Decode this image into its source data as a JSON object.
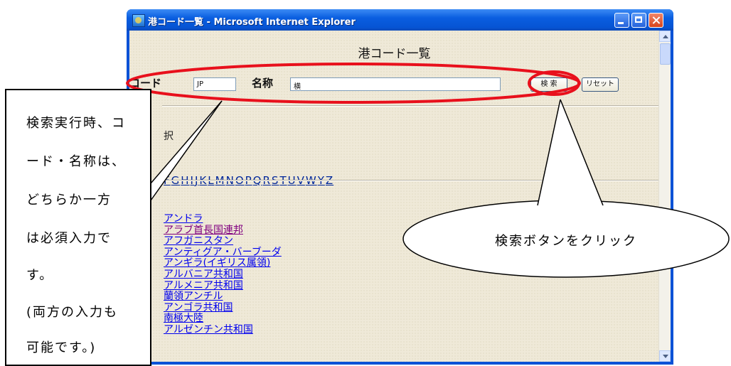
{
  "window": {
    "title": "港コード一覧 - Microsoft Internet Explorer"
  },
  "page": {
    "title": "港コード一覧",
    "code_label": "コード",
    "code_value": "JP",
    "name_label": "名称",
    "name_value": "横",
    "search_button": "検 索",
    "reset_button": "リセット",
    "section_label": "択",
    "alphabet": [
      "F",
      "G",
      "H",
      "I",
      "J",
      "K",
      "L",
      "M",
      "N",
      "O",
      "P",
      "Q",
      "R",
      "S",
      "T",
      "U",
      "V",
      "W",
      "Y",
      "Z"
    ],
    "countries": [
      "アンドラ",
      "アラブ首長国連邦",
      "アフガニスタン",
      "アンティグア・バーブーダ",
      "アンギラ(イギリス属領)",
      "アルバニア共和国",
      "アルメニア共和国",
      "蘭領アンチル",
      "アンゴラ共和国",
      "南極大陸",
      "アルゼンチン共和国"
    ]
  },
  "annotations": {
    "left_callout_lines": [
      "検索実行時、コ",
      "ード・名称は、",
      "どちらか一方",
      "は必須入力で",
      "す。",
      "(両方の入力も",
      "可能です。)"
    ],
    "right_bubble": "検索ボタンをクリック"
  },
  "colors": {
    "accent_red": "#e8101c",
    "link": "#0000ee",
    "visited_link": "#800080"
  }
}
